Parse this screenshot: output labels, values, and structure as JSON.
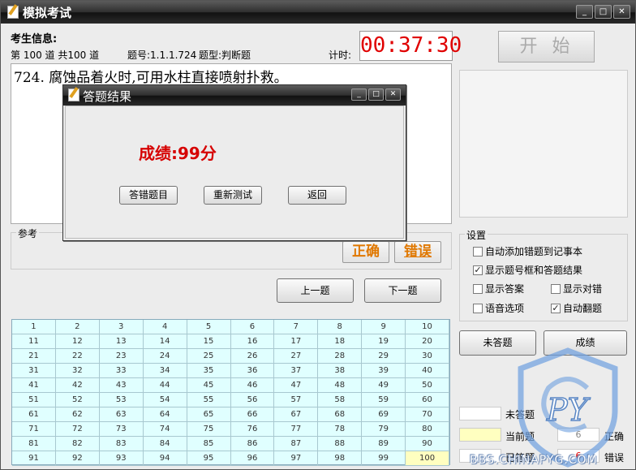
{
  "window": {
    "title": "模拟考试",
    "min": "_",
    "max": "□",
    "close": "✕"
  },
  "header": {
    "candidate_label": "考生信息:",
    "question_progress": "第 100  道  共100   道",
    "question_code": "题号:1.1.1.724",
    "question_type": "题型:判断题",
    "timer_label": "计时:",
    "timer": "00:37:30"
  },
  "start_button": "开始",
  "question": {
    "text": "724. 腐蚀品着火时,可用水柱直接喷射扑救。"
  },
  "reference": {
    "legend": "参考",
    "correct_label": "正确",
    "wrong_label": "错误"
  },
  "nav": {
    "prev": "上一题",
    "next": "下一题"
  },
  "settings": {
    "legend": "设置",
    "options": [
      {
        "label": "自动添加错题到记事本",
        "checked": false
      },
      {
        "label": "显示题号框和答题结果",
        "checked": true
      },
      {
        "label": "显示答案",
        "checked": false
      },
      {
        "label": "显示对错",
        "checked": false
      },
      {
        "label": "语音选项",
        "checked": false
      },
      {
        "label": "自动翻题",
        "checked": true
      }
    ]
  },
  "actions": {
    "unanswered": "未答题",
    "score": "成绩"
  },
  "grid": {
    "current": 100,
    "numbers": [
      1,
      2,
      3,
      4,
      5,
      6,
      7,
      8,
      9,
      10,
      11,
      12,
      13,
      14,
      15,
      16,
      17,
      18,
      19,
      20,
      21,
      22,
      23,
      24,
      25,
      26,
      27,
      28,
      29,
      30,
      31,
      32,
      33,
      34,
      35,
      36,
      37,
      38,
      39,
      40,
      41,
      42,
      43,
      44,
      45,
      46,
      47,
      48,
      49,
      50,
      51,
      52,
      53,
      54,
      55,
      56,
      57,
      58,
      59,
      60,
      61,
      62,
      63,
      64,
      65,
      66,
      67,
      68,
      69,
      70,
      71,
      72,
      73,
      74,
      75,
      76,
      77,
      78,
      79,
      80,
      81,
      82,
      83,
      84,
      85,
      86,
      87,
      88,
      89,
      90,
      91,
      92,
      93,
      94,
      95,
      96,
      97,
      98,
      99,
      100
    ]
  },
  "legend": {
    "unanswered": "未答题",
    "current": "当前题",
    "answered": "已答题",
    "correct_count": "6",
    "correct_label": "正确",
    "wrong_count": "6",
    "wrong_label": "错误"
  },
  "dialog": {
    "title": "答题结果",
    "score": "成绩:99分",
    "wrong_btn": "答错题目",
    "retest_btn": "重新测试",
    "back_btn": "返回"
  },
  "watermark": {
    "letters": "PY",
    "site": "BBS.CHINAPYG.COM"
  },
  "colors": {
    "timer": "#e00000",
    "score": "#d60000",
    "answer": "#e07800",
    "grid_bg": "#e0ffff",
    "current_cell": "#ffffc0"
  }
}
